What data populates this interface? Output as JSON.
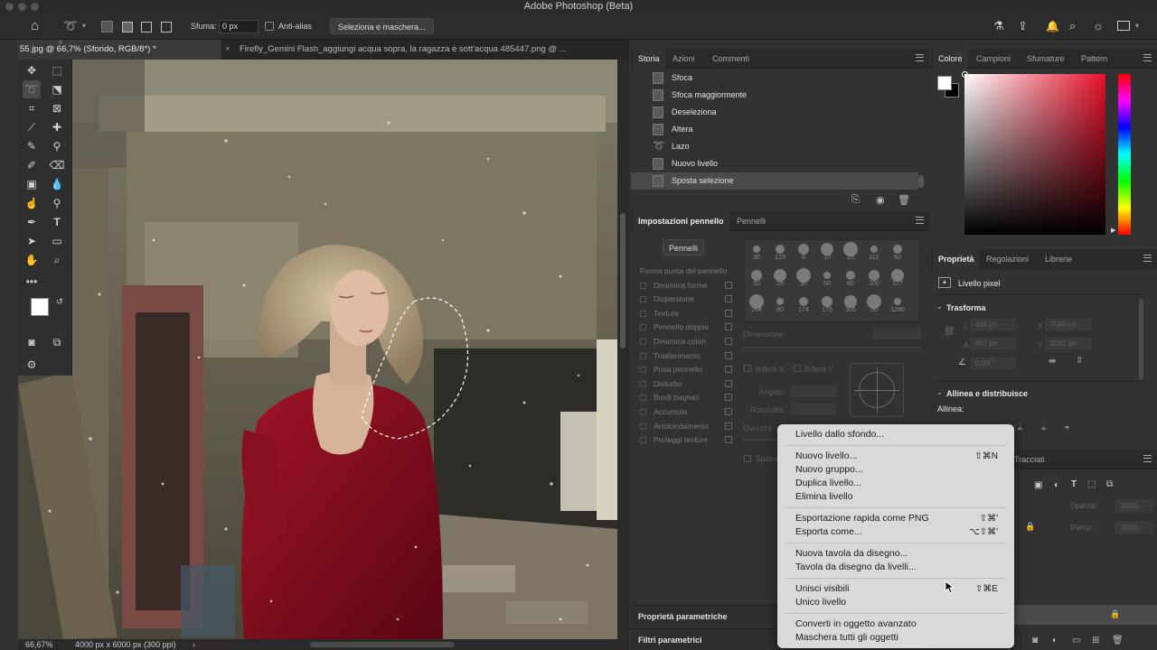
{
  "app": {
    "title": "Adobe Photoshop (Beta)"
  },
  "options": {
    "feather_label": "Sfuma:",
    "feather_value": "0 px",
    "antialias_label": "Anti-alias",
    "select_mask_button": "Seleziona e maschera..."
  },
  "tabs": [
    {
      "label": "55.jpg @ 66,7% (Sfondo, RGB/8*) *"
    },
    {
      "label": "Firefly_Gemini Flash_aggiungi acqua sopra, la ragazza è sott'acqua 485447.png @ ..."
    }
  ],
  "status": {
    "zoom": "66,67%",
    "doc_info": "4000 px x 6000 px (300 ppi)"
  },
  "history_panel": {
    "tabs": [
      "Storia",
      "Azioni",
      "Commenti"
    ],
    "items": [
      {
        "label": "Sfoca",
        "icon": "document-icon"
      },
      {
        "label": "Sfoca maggiormente",
        "icon": "document-icon"
      },
      {
        "label": "Deseleziona",
        "icon": "document-icon"
      },
      {
        "label": "Altera",
        "icon": "document-icon"
      },
      {
        "label": "Lazo",
        "icon": "lasso-icon"
      },
      {
        "label": "Nuovo livello",
        "icon": "document-icon"
      },
      {
        "label": "Sposta selezione",
        "icon": "document-icon"
      }
    ]
  },
  "brush_panel": {
    "tabs": [
      "Impostazioni pennello",
      "Pennelli"
    ],
    "button": "Pennelli",
    "options": [
      "Forma punta del pennello",
      "Dinamica forme",
      "Dispersione",
      "Texture",
      "Pennello doppio",
      "Dinamica colori",
      "Trasferimento",
      "Posa pennello",
      "Disturbo",
      "Bordi bagnati",
      "Accumulo",
      "Arrotondamento",
      "Proteggi texture"
    ],
    "tip_sizes": [
      "30",
      "123",
      "8",
      "10",
      "25",
      "112",
      "60",
      "50",
      "25",
      "30",
      "50",
      "60",
      "100",
      "127",
      "284",
      "80",
      "174",
      "175",
      "306",
      "50",
      "1280"
    ],
    "dimension_label": "Dimensione",
    "flip_x": "Rifletti X",
    "flip_y": "Rifletti Y",
    "angle_label": "Angolo:",
    "roundness_label": "Rotondità:",
    "hardness_label": "Durezza",
    "spacing_label": "Spaziatura"
  },
  "bottom_panels": {
    "param_props": "Proprietà parametriche",
    "param_filters": "Filtri parametrici"
  },
  "color_panel": {
    "tabs": [
      "Colore",
      "Campioni",
      "Sfumature",
      "Pattern"
    ],
    "fg_color": "#ffffff",
    "bg_color": "#000000",
    "hue_color": "#e8102a"
  },
  "props_panel": {
    "tabs": [
      "Proprietà",
      "Regolazioni",
      "Librerie"
    ],
    "layer_type": "Livello pixel",
    "transform_title": "Trasforma",
    "w_label": "L",
    "w_value": "446 px",
    "x_label": "X",
    "x_value": "3080 px",
    "h_label": "A",
    "h_value": "667 px",
    "y_label": "Y",
    "y_value": "2281 px",
    "angle_value": "0,00°",
    "align_title": "Allinea e distribuisce",
    "align_label": "Allinea:"
  },
  "layers_panel": {
    "tab_paths": "Tracciati",
    "opacity_label": "Opacità:",
    "opacity_value": "100%",
    "fill_label": "Riemp.:",
    "fill_value": "100%"
  },
  "context_menu": {
    "groups": [
      [
        {
          "label": "Livello dallo sfondo...",
          "shortcut": ""
        }
      ],
      [
        {
          "label": "Nuovo livello...",
          "shortcut": "⇧⌘N"
        },
        {
          "label": "Nuovo gruppo...",
          "shortcut": ""
        },
        {
          "label": "Duplica livello...",
          "shortcut": ""
        },
        {
          "label": "Elimina livello",
          "shortcut": ""
        }
      ],
      [
        {
          "label": "Esportazione rapida come PNG",
          "shortcut": "⇧⌘'"
        },
        {
          "label": "Esporta come...",
          "shortcut": "⌥⇧⌘'"
        }
      ],
      [
        {
          "label": "Nuova tavola da disegno...",
          "shortcut": ""
        },
        {
          "label": "Tavola da disegno da livelli...",
          "shortcut": ""
        }
      ],
      [
        {
          "label": "Unisci visibili",
          "shortcut": "⇧⌘E"
        },
        {
          "label": "Unico livello",
          "shortcut": ""
        }
      ],
      [
        {
          "label": "Converti in oggetto avanzato",
          "shortcut": ""
        },
        {
          "label": "Maschera tutti gli oggetti",
          "shortcut": ""
        }
      ]
    ]
  }
}
